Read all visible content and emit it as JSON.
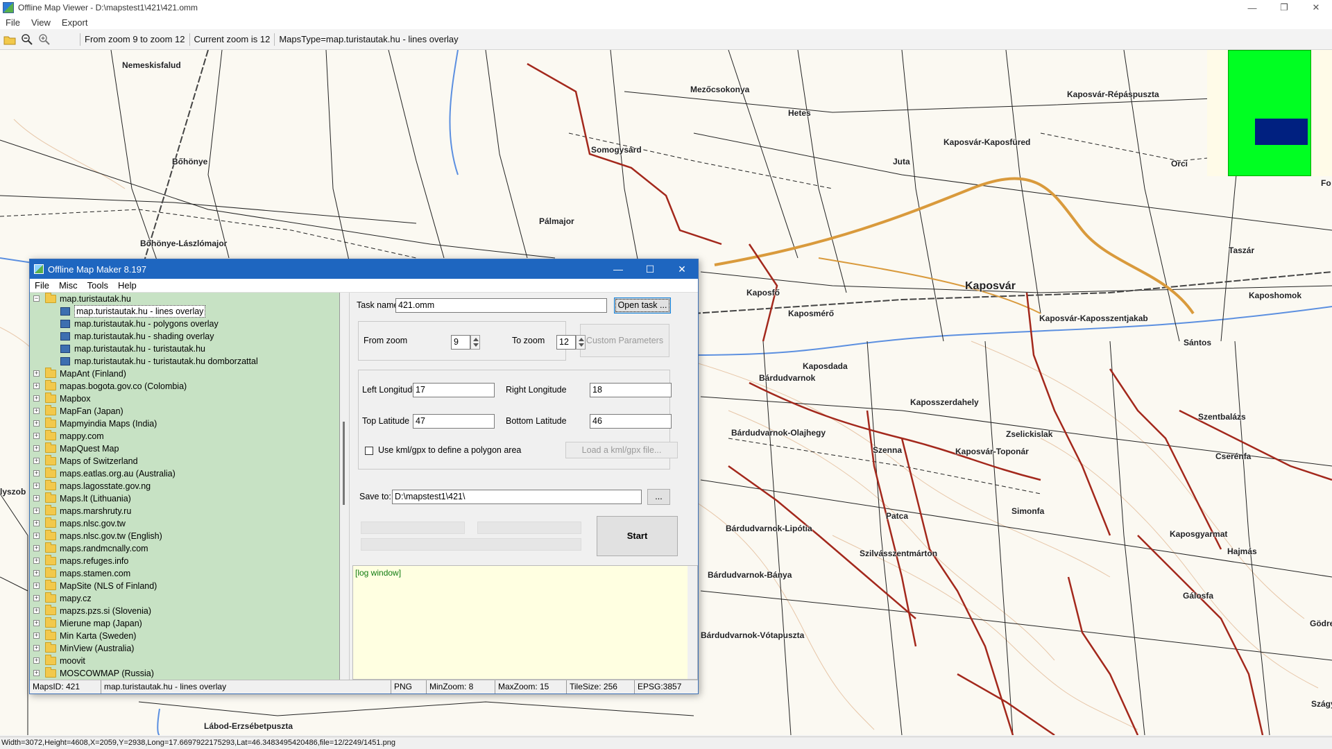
{
  "window": {
    "title": "Offline Map Viewer - D:\\mapstest1\\421\\421.omm",
    "controls": [
      "—",
      "❐",
      "✕"
    ]
  },
  "menu": [
    "File",
    "View",
    "Export"
  ],
  "toolbar": {
    "icons": [
      "open-folder-icon",
      "zoom-out-icon",
      "zoom-in-icon"
    ],
    "zoom_range": "From zoom 9 to zoom 12",
    "current_zoom": "Current zoom is 12",
    "maps_type": "MapsType=map.turistautak.hu - lines overlay"
  },
  "map": {
    "places": [
      {
        "name": "Nemeskisfalud"
      },
      {
        "name": "Bőhönye"
      },
      {
        "name": "Bőhönye-Lászlómajor"
      },
      {
        "name": "Mezőcsokonya"
      },
      {
        "name": "Hetes"
      },
      {
        "name": "Somogysárd"
      },
      {
        "name": "Pálmajor"
      },
      {
        "name": "Juta"
      },
      {
        "name": "Kaposvár-Répáspuszta"
      },
      {
        "name": "Kaposvár-Kaposfüred"
      },
      {
        "name": "Orci"
      },
      {
        "name": "Taszár"
      },
      {
        "name": "Kaposfő"
      },
      {
        "name": "Kaposvár"
      },
      {
        "name": "Kaposhomok"
      },
      {
        "name": "Kaposmérő"
      },
      {
        "name": "Kaposvár-Kaposszentjakab"
      },
      {
        "name": "Sántos"
      },
      {
        "name": "Kaposdada"
      },
      {
        "name": "Bárdudvarnok"
      },
      {
        "name": "Kaposszerdahely"
      },
      {
        "name": "Szentbalázs"
      },
      {
        "name": "Bárdudvarnok-Olajhegy"
      },
      {
        "name": "Zselickislak"
      },
      {
        "name": "Szenna"
      },
      {
        "name": "Kaposvár-Toponár"
      },
      {
        "name": "Cserénfa"
      },
      {
        "name": "Patca"
      },
      {
        "name": "Simonfa"
      },
      {
        "name": "Bárdudvarnok-Lipótia"
      },
      {
        "name": "Szilvásszentmárton"
      },
      {
        "name": "Kaposgyarmat"
      },
      {
        "name": "Hajmás"
      },
      {
        "name": "Bárdudvarnok-Bánya"
      },
      {
        "name": "Gálosfa"
      },
      {
        "name": "Bárdudvarnok-Vótapuszta"
      },
      {
        "name": "Gödre"
      },
      {
        "name": "Szágy"
      },
      {
        "name": "Lábod-Erzsébetpuszta"
      },
      {
        "name": "lyszob"
      },
      {
        "name": "Fo"
      }
    ]
  },
  "status_main": "Width=3072,Height=4608,X=2059,Y=2938,Long=17.6697922175293,Lat=46.3483495420486,file=12/2249/1451.png",
  "dialog": {
    "title": "Offline Map Maker 8.197",
    "controls": [
      "—",
      "☐",
      "✕"
    ],
    "menu": [
      "File",
      "Misc",
      "Tools",
      "Help"
    ],
    "tree": [
      {
        "label": "map.turistautak.hu",
        "type": "folder",
        "expanded": true
      },
      {
        "label": "map.turistautak.hu - lines overlay",
        "type": "leaf",
        "selected": true
      },
      {
        "label": "map.turistautak.hu - polygons overlay",
        "type": "leaf"
      },
      {
        "label": "map.turistautak.hu - shading overlay",
        "type": "leaf"
      },
      {
        "label": "map.turistautak.hu - turistautak.hu",
        "type": "leaf"
      },
      {
        "label": "map.turistautak.hu - turistautak.hu domborzattal",
        "type": "leaf"
      },
      {
        "label": "MapAnt (Finland)",
        "type": "folder"
      },
      {
        "label": "mapas.bogota.gov.co (Colombia)",
        "type": "folder"
      },
      {
        "label": "Mapbox",
        "type": "folder"
      },
      {
        "label": "MapFan (Japan)",
        "type": "folder"
      },
      {
        "label": "Mapmyindia Maps (India)",
        "type": "folder"
      },
      {
        "label": "mappy.com",
        "type": "folder"
      },
      {
        "label": "MapQuest Map",
        "type": "folder"
      },
      {
        "label": "Maps of Switzerland",
        "type": "folder"
      },
      {
        "label": "maps.eatlas.org.au (Australia)",
        "type": "folder"
      },
      {
        "label": "maps.lagosstate.gov.ng",
        "type": "folder"
      },
      {
        "label": "Maps.lt (Lithuania)",
        "type": "folder"
      },
      {
        "label": "maps.marshruty.ru",
        "type": "folder"
      },
      {
        "label": "maps.nlsc.gov.tw",
        "type": "folder"
      },
      {
        "label": "maps.nlsc.gov.tw (English)",
        "type": "folder"
      },
      {
        "label": "maps.randmcnally.com",
        "type": "folder"
      },
      {
        "label": "maps.refuges.info",
        "type": "folder"
      },
      {
        "label": "maps.stamen.com",
        "type": "folder"
      },
      {
        "label": "MapSite (NLS of Finland)",
        "type": "folder"
      },
      {
        "label": "mapy.cz",
        "type": "folder"
      },
      {
        "label": "mapzs.pzs.si (Slovenia)",
        "type": "folder"
      },
      {
        "label": "Mierune map (Japan)",
        "type": "folder"
      },
      {
        "label": "Min Karta (Sweden)",
        "type": "folder"
      },
      {
        "label": "MinView (Australia)",
        "type": "folder"
      },
      {
        "label": "moovit",
        "type": "folder"
      },
      {
        "label": "MOSCOWMAP (Russia)",
        "type": "folder"
      }
    ],
    "task": {
      "task_name_label": "Task name",
      "task_name_value": "421.omm",
      "open_task": "Open task ...",
      "from_zoom_label": "From zoom",
      "from_zoom_value": "9",
      "to_zoom_label": "To zoom",
      "to_zoom_value": "12",
      "custom_parameters": "Custom Parameters",
      "left_lon_label": "Left Longitude",
      "left_lon_value": "17",
      "right_lon_label": "Right Longitude",
      "right_lon_value": "18",
      "top_lat_label": "Top Latitude",
      "top_lat_value": "47",
      "bottom_lat_label": "Bottom Latitude",
      "bottom_lat_value": "46",
      "use_kml_label": "Use kml/gpx to define a polygon area",
      "load_kml": "Load a kml/gpx file...",
      "save_to_label": "Save to:",
      "save_to_value": "D:\\mapstest1\\421\\",
      "browse": "...",
      "start": "Start",
      "log": "[log window]"
    },
    "status": {
      "maps_id": "MapsID: 421",
      "map_name": "map.turistautak.hu - lines overlay",
      "format": "PNG",
      "min_zoom": "MinZoom: 8",
      "max_zoom": "MaxZoom: 15",
      "tile_size": "TileSize: 256",
      "epsg": "EPSG:3857"
    }
  }
}
